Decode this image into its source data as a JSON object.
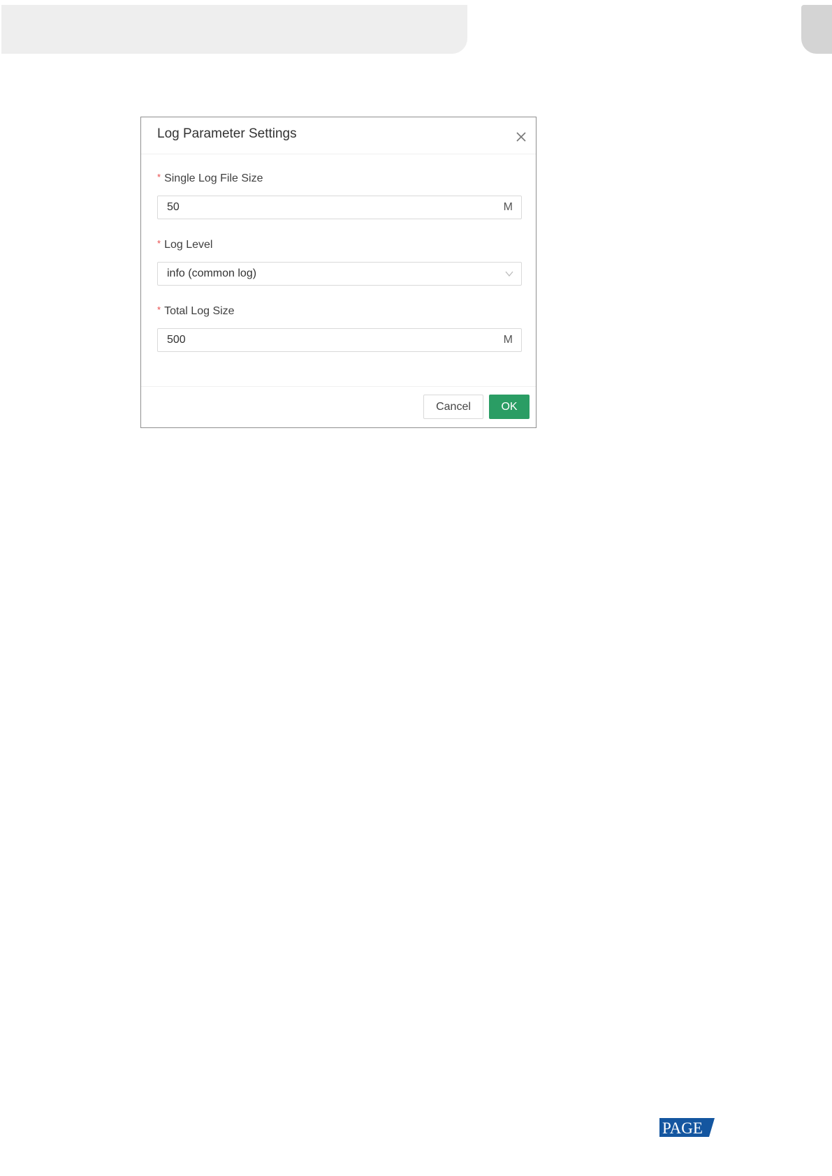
{
  "dialog": {
    "title": "Log Parameter Settings",
    "close_icon": "close-icon",
    "fields": [
      {
        "required_mark": "*",
        "label": "Single Log File Size",
        "value": "50",
        "suffix": "M"
      },
      {
        "required_mark": "*",
        "label": "Log Level",
        "value": "info (common log)",
        "icon": "chevron-down-icon"
      },
      {
        "required_mark": "*",
        "label": "Total Log Size",
        "value": "500",
        "suffix": "M"
      }
    ],
    "buttons": {
      "cancel_label": "Cancel",
      "ok_label": "OK"
    }
  },
  "colors": {
    "accent": "#2a9d64",
    "required": "#e84b4b",
    "border": "#d9d9d9"
  },
  "footer_logo": "PAGE"
}
